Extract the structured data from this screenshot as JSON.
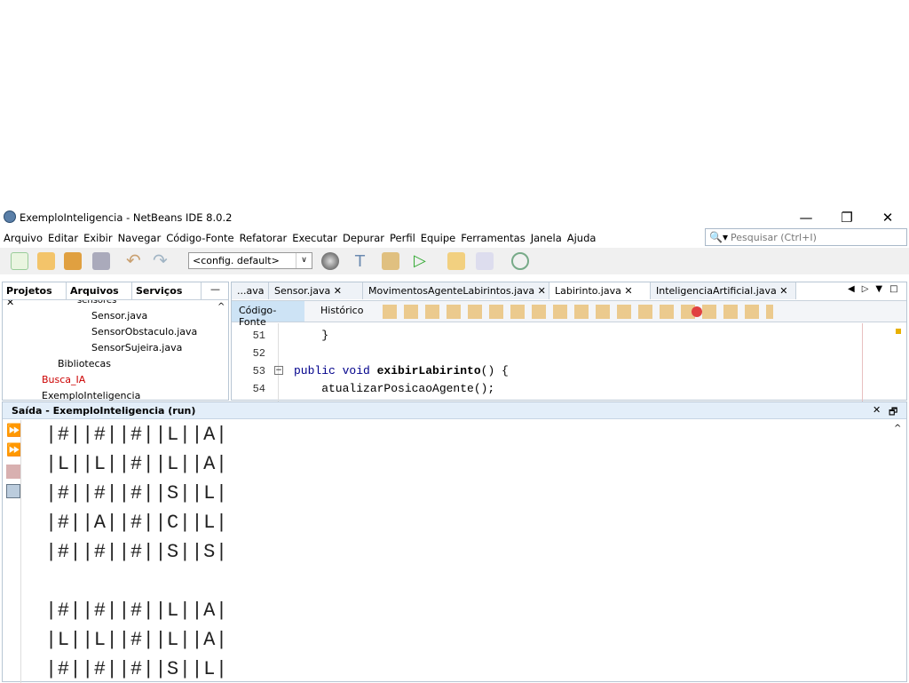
{
  "window": {
    "title": "ExemploInteligencia - NetBeans IDE 8.0.2"
  },
  "menu": [
    "Arquivo",
    "Editar",
    "Exibir",
    "Navegar",
    "Código-Fonte",
    "Refatorar",
    "Executar",
    "Depurar",
    "Perfil",
    "Equipe",
    "Ferramentas",
    "Janela",
    "Ajuda"
  ],
  "search": {
    "placeholder": "Pesquisar (Ctrl+I)"
  },
  "toolbar": {
    "config": "<config. default>"
  },
  "left_panel": {
    "tabs": [
      "Projetos",
      "Arquivos",
      "Serviços"
    ],
    "tree": [
      "sensores",
      "Sensor.java",
      "SensorObstaculo.java",
      "SensorSujeira.java",
      "Bibliotecas",
      "Busca_IA",
      "ExemploInteligencia"
    ]
  },
  "editor": {
    "tabs": [
      "...ava",
      "Sensor.java",
      "MovimentosAgenteLabirintos.java",
      "Labirinto.java",
      "InteligenciaArtificial.java"
    ],
    "active_tab": "Labirinto.java",
    "view_tabs": [
      "Código-Fonte",
      "Histórico"
    ],
    "lines": [
      {
        "n": "51",
        "code": "    }"
      },
      {
        "n": "52",
        "code": ""
      },
      {
        "n": "53",
        "code": "  public void exibirLabirinto() {"
      },
      {
        "n": "54",
        "code": "    atualizarPosicaoAgente();"
      }
    ]
  },
  "output": {
    "title": "Saída - ExemploInteligencia (run)",
    "lines": [
      "|#||#||#||L||A|",
      "|L||L||#||L||A|",
      "|#||#||#||S||L|",
      "|#||A||#||C||L|",
      "|#||#||#||S||S|",
      "",
      "|#||#||#||L||A|",
      "|L||L||#||L||A|",
      "|#||#||#||S||L|"
    ]
  }
}
